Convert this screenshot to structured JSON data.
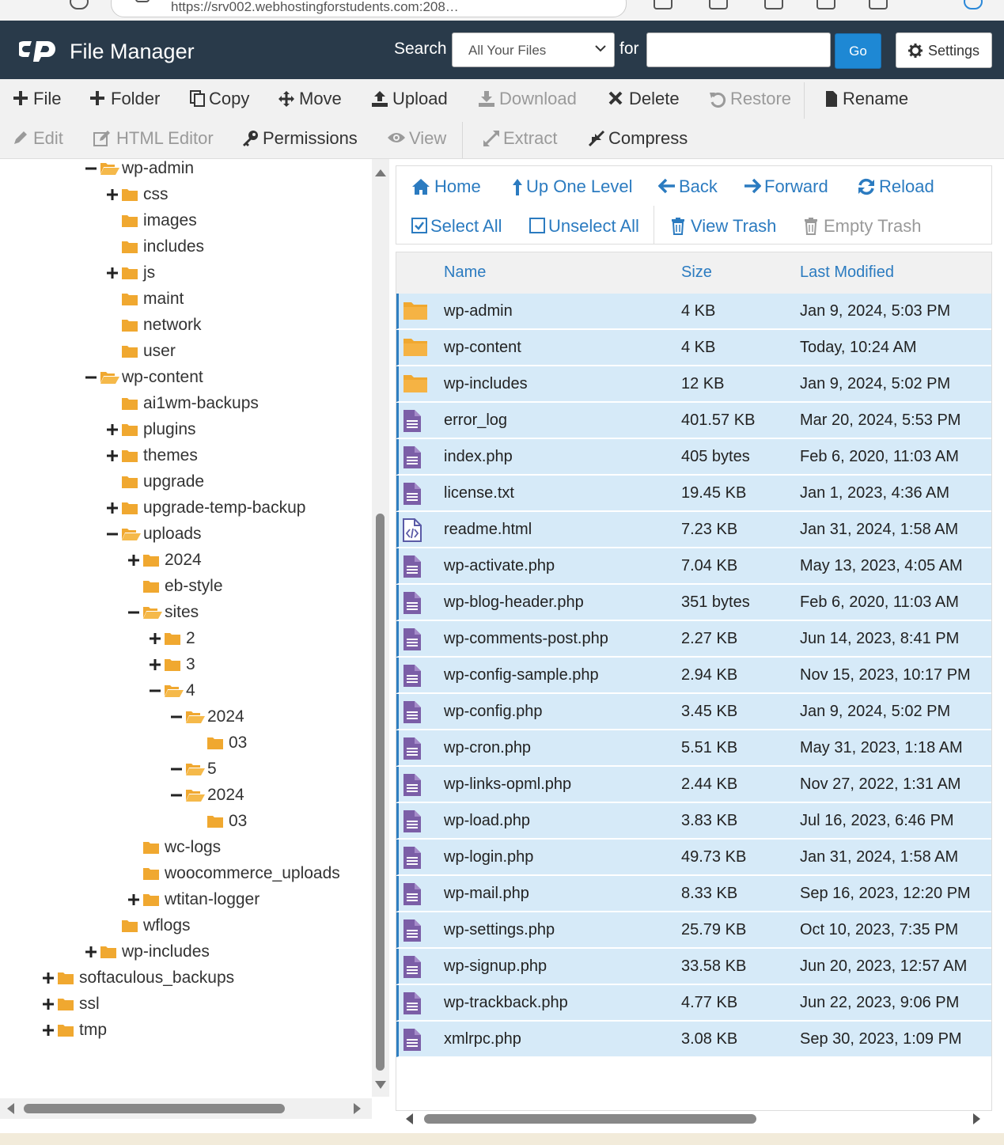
{
  "browser": {
    "url": "https://srv002.webhostingforstudents.com:208…"
  },
  "app": {
    "title": "File Manager",
    "logo_icon": "cpanel-logo-icon",
    "header_bg": "#293a4a"
  },
  "search": {
    "label": "Search",
    "scope": "All Your Files",
    "for_label": "for",
    "query": "",
    "go_label": "Go",
    "settings_label": "Settings"
  },
  "toolbar": {
    "file": "File",
    "folder": "Folder",
    "copy": "Copy",
    "move": "Move",
    "upload": "Upload",
    "download": "Download",
    "delete": "Delete",
    "restore": "Restore",
    "rename": "Rename",
    "edit": "Edit",
    "html_editor": "HTML Editor",
    "permissions": "Permissions",
    "view": "View",
    "extract": "Extract",
    "compress": "Compress"
  },
  "tree": [
    {
      "name": "wp-admin",
      "toggle": "minus",
      "open": true
    },
    {
      "name": "css",
      "toggle": "plus",
      "open": false
    },
    {
      "name": "images",
      "toggle": "none",
      "open": false
    },
    {
      "name": "includes",
      "toggle": "none",
      "open": false
    },
    {
      "name": "js",
      "toggle": "plus",
      "open": false
    },
    {
      "name": "maint",
      "toggle": "none",
      "open": false
    },
    {
      "name": "network",
      "toggle": "none",
      "open": false
    },
    {
      "name": "user",
      "toggle": "none",
      "open": false
    },
    {
      "name": "wp-content",
      "toggle": "minus",
      "open": true
    },
    {
      "name": "ai1wm-backups",
      "toggle": "none",
      "open": false
    },
    {
      "name": "plugins",
      "toggle": "plus",
      "open": false
    },
    {
      "name": "themes",
      "toggle": "plus",
      "open": false
    },
    {
      "name": "upgrade",
      "toggle": "none",
      "open": false
    },
    {
      "name": "upgrade-temp-backup",
      "toggle": "plus",
      "open": false
    },
    {
      "name": "uploads",
      "toggle": "minus",
      "open": true
    },
    {
      "name": "2024",
      "toggle": "plus",
      "open": false
    },
    {
      "name": "eb-style",
      "toggle": "none",
      "open": false
    },
    {
      "name": "sites",
      "toggle": "minus",
      "open": true
    },
    {
      "name": "2",
      "toggle": "plus",
      "open": false
    },
    {
      "name": "3",
      "toggle": "plus",
      "open": false
    },
    {
      "name": "4",
      "toggle": "minus",
      "open": true
    },
    {
      "name": "2024",
      "toggle": "minus",
      "open": true
    },
    {
      "name": "03",
      "toggle": "none",
      "open": false
    },
    {
      "name": "5",
      "toggle": "minus",
      "open": true
    },
    {
      "name": "2024",
      "toggle": "minus",
      "open": true
    },
    {
      "name": "03",
      "toggle": "none",
      "open": false
    },
    {
      "name": "wc-logs",
      "toggle": "none",
      "open": false
    },
    {
      "name": "woocommerce_uploads",
      "toggle": "none",
      "open": false
    },
    {
      "name": "wtitan-logger",
      "toggle": "plus",
      "open": false
    },
    {
      "name": "wflogs",
      "toggle": "none",
      "open": false
    },
    {
      "name": "wp-includes",
      "toggle": "plus",
      "open": false
    },
    {
      "name": "softaculous_backups",
      "toggle": "plus",
      "open": false
    },
    {
      "name": "ssl",
      "toggle": "plus",
      "open": false
    },
    {
      "name": "tmp",
      "toggle": "plus",
      "open": false
    }
  ],
  "nav": {
    "home": "Home",
    "up": "Up One Level",
    "back": "Back",
    "forward": "Forward",
    "reload": "Reload",
    "select_all": "Select All",
    "unselect_all": "Unselect All",
    "view_trash": "View Trash",
    "empty_trash": "Empty Trash"
  },
  "table": {
    "col_name": "Name",
    "col_size": "Size",
    "col_modified": "Last Modified",
    "selected_bg": "#d6eaf8",
    "rows": [
      {
        "name": "wp-admin",
        "size": "4 KB",
        "modified": "Jan 9, 2024, 5:03 PM",
        "type": "folder"
      },
      {
        "name": "wp-content",
        "size": "4 KB",
        "modified": "Today, 10:24 AM",
        "type": "folder"
      },
      {
        "name": "wp-includes",
        "size": "12 KB",
        "modified": "Jan 9, 2024, 5:02 PM",
        "type": "folder"
      },
      {
        "name": "error_log",
        "size": "401.57 KB",
        "modified": "Mar 20, 2024, 5:53 PM",
        "type": "text"
      },
      {
        "name": "index.php",
        "size": "405 bytes",
        "modified": "Feb 6, 2020, 11:03 AM",
        "type": "text"
      },
      {
        "name": "license.txt",
        "size": "19.45 KB",
        "modified": "Jan 1, 2023, 4:36 AM",
        "type": "text"
      },
      {
        "name": "readme.html",
        "size": "7.23 KB",
        "modified": "Jan 31, 2024, 1:58 AM",
        "type": "code"
      },
      {
        "name": "wp-activate.php",
        "size": "7.04 KB",
        "modified": "May 13, 2023, 4:05 AM",
        "type": "text"
      },
      {
        "name": "wp-blog-header.php",
        "size": "351 bytes",
        "modified": "Feb 6, 2020, 11:03 AM",
        "type": "text"
      },
      {
        "name": "wp-comments-post.php",
        "size": "2.27 KB",
        "modified": "Jun 14, 2023, 8:41 PM",
        "type": "text"
      },
      {
        "name": "wp-config-sample.php",
        "size": "2.94 KB",
        "modified": "Nov 15, 2023, 10:17 PM",
        "type": "text"
      },
      {
        "name": "wp-config.php",
        "size": "3.45 KB",
        "modified": "Jan 9, 2024, 5:02 PM",
        "type": "text"
      },
      {
        "name": "wp-cron.php",
        "size": "5.51 KB",
        "modified": "May 31, 2023, 1:18 AM",
        "type": "text"
      },
      {
        "name": "wp-links-opml.php",
        "size": "2.44 KB",
        "modified": "Nov 27, 2022, 1:31 AM",
        "type": "text"
      },
      {
        "name": "wp-load.php",
        "size": "3.83 KB",
        "modified": "Jul 16, 2023, 6:46 PM",
        "type": "text"
      },
      {
        "name": "wp-login.php",
        "size": "49.73 KB",
        "modified": "Jan 31, 2024, 1:58 AM",
        "type": "text"
      },
      {
        "name": "wp-mail.php",
        "size": "8.33 KB",
        "modified": "Sep 16, 2023, 12:20 PM",
        "type": "text"
      },
      {
        "name": "wp-settings.php",
        "size": "25.79 KB",
        "modified": "Oct 10, 2023, 7:35 PM",
        "type": "text"
      },
      {
        "name": "wp-signup.php",
        "size": "33.58 KB",
        "modified": "Jun 20, 2023, 12:57 AM",
        "type": "text"
      },
      {
        "name": "wp-trackback.php",
        "size": "4.77 KB",
        "modified": "Jun 22, 2023, 9:06 PM",
        "type": "text"
      },
      {
        "name": "xmlrpc.php",
        "size": "3.08 KB",
        "modified": "Sep 30, 2023, 1:09 PM",
        "type": "text"
      }
    ]
  }
}
